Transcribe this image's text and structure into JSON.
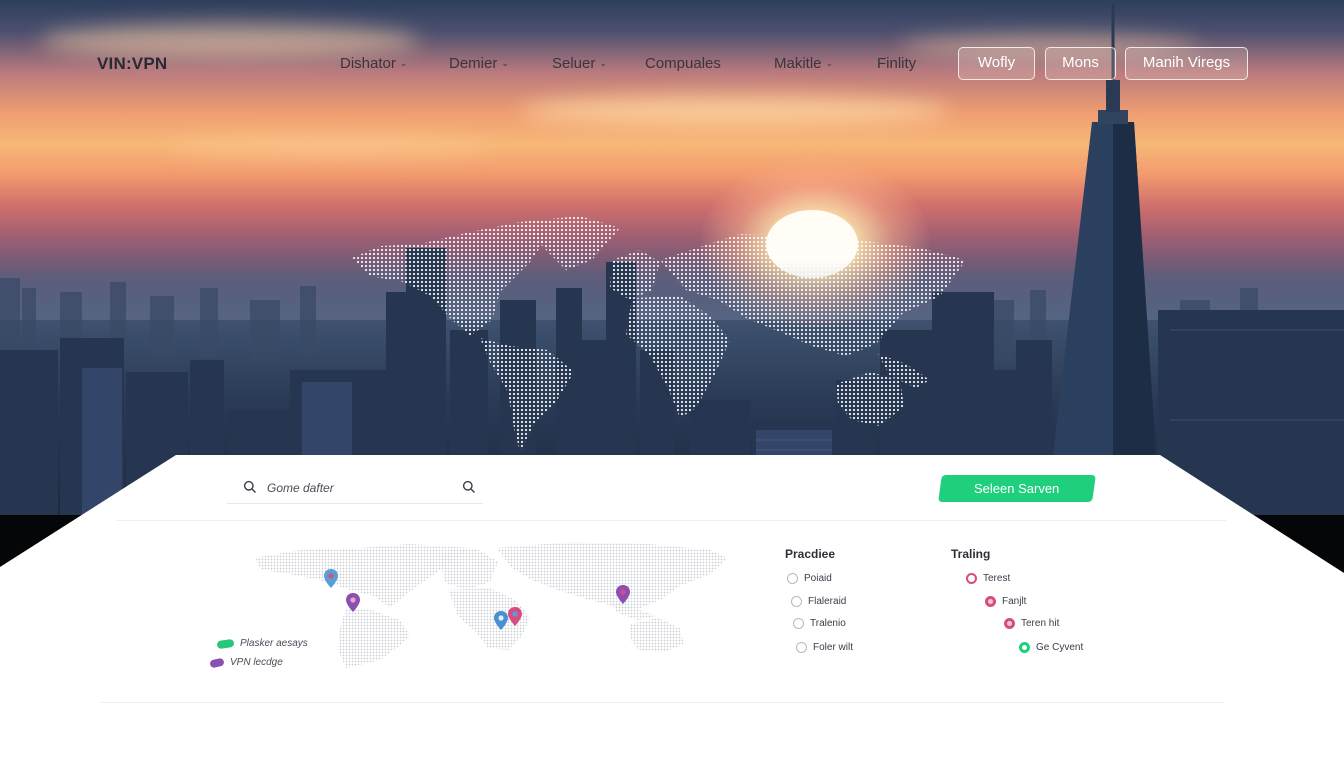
{
  "brand": {
    "name": "VIN:VPN"
  },
  "nav": {
    "items": [
      {
        "label": "Dishator",
        "has_chevron": true
      },
      {
        "label": "Demier",
        "has_chevron": true
      },
      {
        "label": "Seluer",
        "has_chevron": true
      },
      {
        "label": "Compuales",
        "has_chevron": false
      },
      {
        "label": "Makitle",
        "has_chevron": true
      },
      {
        "label": "Finlity",
        "has_chevron": false
      }
    ],
    "chevron_glyph": "⌄",
    "buttons": [
      {
        "label": "Wofly"
      },
      {
        "label": "Mons"
      },
      {
        "label": "Manih Viregs"
      }
    ]
  },
  "panel": {
    "search": {
      "value": "Gome dafter",
      "icon": "search-icon"
    },
    "cta_label": "Seleen Sarven",
    "legend": [
      {
        "label": "Plasker aesays",
        "color": "#27c77a"
      },
      {
        "label": "VPN lecdge",
        "color": "#8a4fb0"
      }
    ],
    "columns": [
      {
        "title": "Pracdiee",
        "options": [
          {
            "label": "Poiaid",
            "state": "empty"
          },
          {
            "label": "Flaleraid",
            "state": "empty"
          },
          {
            "label": "Tralenio",
            "state": "empty"
          },
          {
            "label": "Foler wilt",
            "state": "empty"
          }
        ]
      },
      {
        "title": "Traling",
        "options": [
          {
            "label": "Terest",
            "state": "pink-outline"
          },
          {
            "label": "Fanjlt",
            "state": "pink-filled"
          },
          {
            "label": "Teren hit",
            "state": "pink-filled"
          },
          {
            "label": "Ge Cyvent",
            "state": "green-filled"
          }
        ]
      }
    ]
  },
  "colors": {
    "accent_green": "#1fcf7c",
    "accent_pink": "#d64d81",
    "legend_purple": "#8a4fb0",
    "map_dots": "#cfd1d6",
    "hero_map": "#ffffff"
  }
}
